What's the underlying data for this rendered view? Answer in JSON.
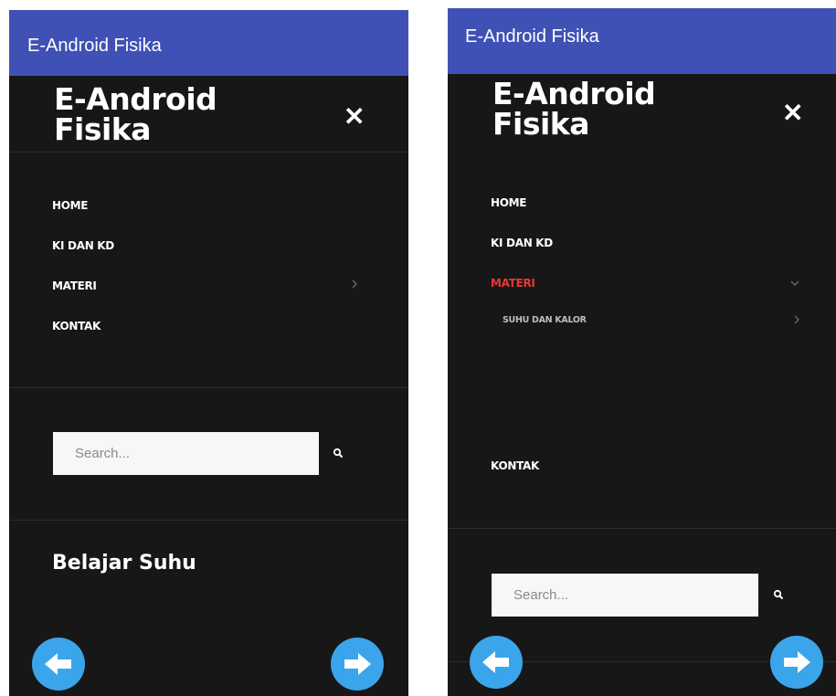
{
  "app_title": "E-Android Fisika",
  "brand": {
    "line1": "E-Android",
    "line2": "Fisika"
  },
  "close_glyph": "✕",
  "menu": {
    "home": "HOME",
    "ki_kd": "KI DAN KD",
    "materi": "MATERI",
    "kontak": "KONTAK",
    "submenu_suhu": "SUHU DAN KALOR"
  },
  "search": {
    "placeholder": "Search..."
  },
  "widget": {
    "title": "Belajar Suhu"
  },
  "colors": {
    "appbar": "#3f51b5",
    "drawer": "#171717",
    "active": "#e53935",
    "fab": "#3aa5ea"
  },
  "icons": {
    "close": "close-icon",
    "chevron_right": "chevron-right-icon",
    "chevron_down": "chevron-down-icon",
    "search": "search-icon",
    "back": "arrow-left-icon",
    "forward": "arrow-right-icon"
  }
}
